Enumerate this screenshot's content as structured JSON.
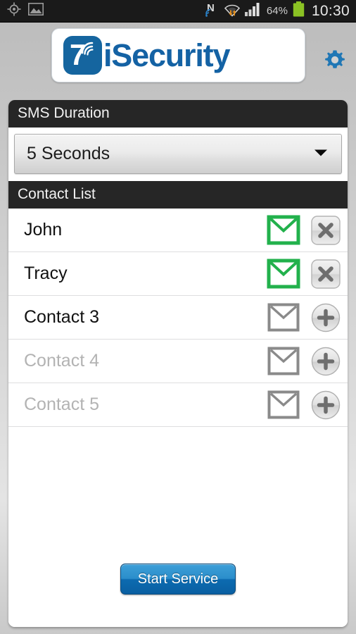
{
  "status_bar": {
    "icons_left": [
      "gps-icon",
      "image-icon"
    ],
    "icons_right": [
      "nfc-icon",
      "wifi-icon",
      "signal-icon",
      "battery-icon"
    ],
    "battery_percent": "64%",
    "time": "10:30"
  },
  "header": {
    "logo_badge_text": "7",
    "logo_badge_icon": "wifi-waves-icon",
    "app_title": "iSecurity",
    "settings_icon": "gear-icon"
  },
  "sms_duration": {
    "section_title": "SMS Duration",
    "selected_value": "5 Seconds",
    "dropdown_icon": "chevron-down-icon"
  },
  "contact_list": {
    "section_title": "Contact List",
    "rows": [
      {
        "name": "John",
        "muted": false,
        "envelope_state": "active",
        "action": "remove"
      },
      {
        "name": "Tracy",
        "muted": false,
        "envelope_state": "active",
        "action": "remove"
      },
      {
        "name": "Contact 3",
        "muted": false,
        "envelope_state": "inactive",
        "action": "add"
      },
      {
        "name": "Contact 4",
        "muted": true,
        "envelope_state": "inactive",
        "action": "add"
      },
      {
        "name": "Contact 5",
        "muted": true,
        "envelope_state": "inactive",
        "action": "add"
      }
    ]
  },
  "footer": {
    "start_button_label": "Start Service"
  },
  "colors": {
    "brand_blue": "#15659f",
    "logo_text_blue": "#1462a4",
    "section_header_bg": "#262626",
    "envelope_active_green": "#22b14c",
    "envelope_inactive_gray": "#8a8a8a",
    "button_blue": "#0c6bb0",
    "muted_text": "#b3b3b3"
  }
}
